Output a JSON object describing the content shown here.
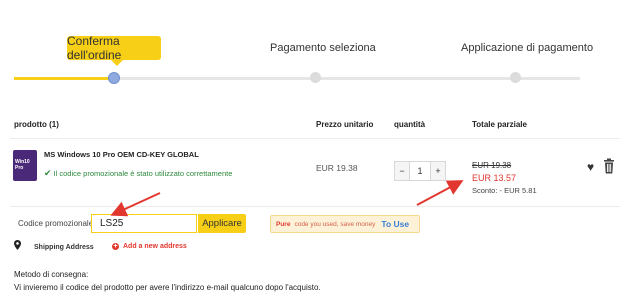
{
  "steps": [
    {
      "label": "Conferma dell'ordine",
      "active": true
    },
    {
      "label": "Pagamento seleziona",
      "active": false
    },
    {
      "label": "Applicazione di pagamento",
      "active": false
    }
  ],
  "table": {
    "headers": {
      "product": "prodotto (1)",
      "unit_price": "Prezzo unitario",
      "quantity": "quantità",
      "subtotal": "Totale parziale"
    }
  },
  "item": {
    "thumb_text": "Win10 Pro",
    "name": "MS Windows 10 Pro OEM CD-KEY GLOBAL",
    "promo_message": "Il codice promozionale è stato utilizzato correttamente",
    "unit_price": "EUR 19.38",
    "quantity": "1",
    "minus": "−",
    "plus": "+",
    "old_total": "EUR 19.38",
    "new_total": "EUR 13.57",
    "saving": "Sconto: - EUR 5.81"
  },
  "promo": {
    "label": "Codice promozionale:",
    "code": "LS25",
    "apply": "Applicare",
    "tip_brand": "Pure",
    "tip_text": "code you used, save money",
    "tip_link": "To Use"
  },
  "shipping": {
    "label": "Shipping Address",
    "add": "Add a new address"
  },
  "delivery": {
    "title": "Metodo di consegna:",
    "text": "Vi invieremo il codice del prodotto per avere l'indirizzo e-mail qualcuno dopo l'acquisto."
  },
  "colors": {
    "accent": "#f6cf16",
    "price_red": "#e2372f",
    "success_green": "#2d8a3e",
    "link_blue": "#3a7fd5"
  }
}
